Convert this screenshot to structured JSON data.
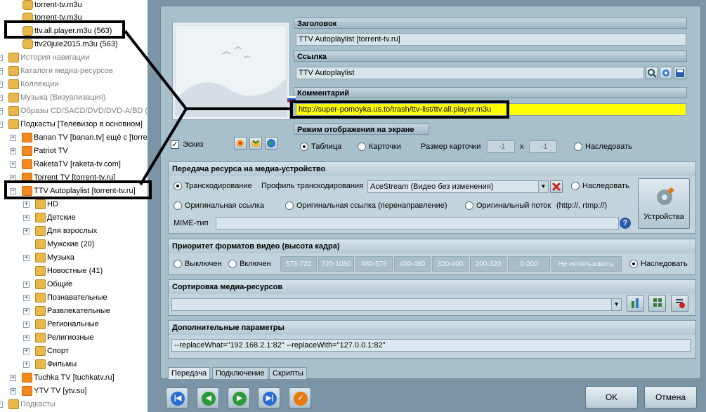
{
  "tree": {
    "items": [
      {
        "label": "torrent-tv.m3u",
        "icon": "file-icon",
        "style": "normal"
      },
      {
        "label": "torrent-tv.m3u",
        "icon": "file-icon",
        "style": "normal"
      },
      {
        "label": "ttv.all.player.m3u (563)",
        "icon": "file-icon",
        "style": "normal"
      },
      {
        "label": "ttv20jule2015.m3u (563)",
        "icon": "file-icon",
        "style": "normal"
      },
      {
        "label": "История навигации",
        "icon": "folder-icon",
        "style": "gray"
      },
      {
        "label": "Каталоги медиа-ресурсов",
        "icon": "folder-icon",
        "style": "gray"
      },
      {
        "label": "Коллекции",
        "icon": "folder-icon",
        "style": "gray"
      },
      {
        "label": "Музыка (Визуализация)",
        "icon": "folder-icon",
        "style": "gray"
      },
      {
        "label": "Образы CD/SACD/DVD/DVD-A/BD (IS",
        "icon": "folder-icon",
        "style": "gray"
      },
      {
        "label": "Подкасты [Телевизор в основном]",
        "icon": "folder-icon",
        "style": "normal"
      },
      {
        "label": "Banan TV [banan.tv] ещё с [torre",
        "icon": "rss-icon",
        "style": "normal"
      },
      {
        "label": "Patriot TV",
        "icon": "rss-icon",
        "style": "normal"
      },
      {
        "label": "RaketaTV [raketa-tv.com]",
        "icon": "rss-icon",
        "style": "normal"
      },
      {
        "label": "Torrent TV [torrent-tv.ru]",
        "icon": "rss-icon",
        "style": "normal"
      },
      {
        "label": "TTV Autoplaylist [torrent-tv.ru]",
        "icon": "rss-icon",
        "style": "normal"
      },
      {
        "label": "HD",
        "icon": "folder-icon",
        "style": "normal"
      },
      {
        "label": "Детские",
        "icon": "folder-icon",
        "style": "normal"
      },
      {
        "label": "Для взрослых",
        "icon": "folder-icon",
        "style": "normal"
      },
      {
        "label": "Мужские (20)",
        "icon": "folder-icon",
        "style": "normal"
      },
      {
        "label": "Музыка",
        "icon": "folder-icon",
        "style": "normal"
      },
      {
        "label": "Новостные (41)",
        "icon": "folder-icon",
        "style": "normal"
      },
      {
        "label": "Общие",
        "icon": "folder-icon",
        "style": "normal"
      },
      {
        "label": "Познавательные",
        "icon": "folder-icon",
        "style": "normal"
      },
      {
        "label": "Развлекательные",
        "icon": "folder-icon",
        "style": "normal"
      },
      {
        "label": "Региональные",
        "icon": "folder-icon",
        "style": "normal"
      },
      {
        "label": "Религиозные",
        "icon": "folder-icon",
        "style": "normal"
      },
      {
        "label": "Спорт",
        "icon": "folder-icon",
        "style": "normal"
      },
      {
        "label": "Фильмы",
        "icon": "folder-icon",
        "style": "normal"
      },
      {
        "label": "Tuchka TV [tuchkatv.ru]",
        "icon": "rss-icon",
        "style": "normal"
      },
      {
        "label": "YTV TV [ytv.su]",
        "icon": "rss-icon",
        "style": "normal"
      },
      {
        "label": "Подкасты",
        "icon": "folder-icon",
        "style": "gray"
      }
    ]
  },
  "props": {
    "title_header": "Заголовок",
    "title_value": "TTV Autoplaylist [torrent-tv.ru]",
    "link_header": "Ссылка",
    "link_value": "TTV Autoplaylist",
    "comment_header": "Комментарий",
    "comment_value": "http://super-pomoyka.us.to/trash/ttv-list/ttv.all.player.m3u",
    "comment_highlight": "#ffff00",
    "display_header": "Режим отображения на экране",
    "thumb_label": "Эскиз",
    "mode_table": "Таблица",
    "mode_cards": "Карточки",
    "card_size_label": "Размер карточки",
    "card_w": "-1",
    "card_x": "x",
    "card_h": "-1",
    "inherit": "Наследовать"
  },
  "transfer": {
    "header": "Передача ресурса на медиа-устройство",
    "transcoding": "Транскодирование",
    "profile_label": "Профиль транскодирования",
    "profile_value": "AceStream (Видео без изменения)",
    "inherit": "Наследовать",
    "orig_link": "Оригинальная ссылка",
    "orig_redirect": "Оригинальная ссылка (перенаправление)",
    "orig_stream": "Оригинальный поток",
    "orig_stream_hint": "(http://, rtmp://)",
    "mime_label": "MIME-тип",
    "mime_value": "",
    "devices_button": "Устройства"
  },
  "priority": {
    "header": "Приоритет форматов видео (высота кадра)",
    "off": "Выключен",
    "on": "Включен",
    "formats": [
      "576-720",
      "720-1080",
      "480-576",
      "400-480",
      "320-400",
      "200-320",
      "0-200",
      "Не использовать:"
    ],
    "inherit": "Наследовать"
  },
  "sorting": {
    "header": "Сортировка медиа-ресурсов",
    "value": ""
  },
  "extra": {
    "header": "Дополнительные параметры",
    "value": "--replaceWhat=\"192.168.2.1:82\" --replaceWith=\"127.0.0.1:82\""
  },
  "tabs": [
    "Передача",
    "Подключение",
    "Скрипты"
  ],
  "footer": {
    "ok": "OK",
    "cancel": "Отмена"
  }
}
